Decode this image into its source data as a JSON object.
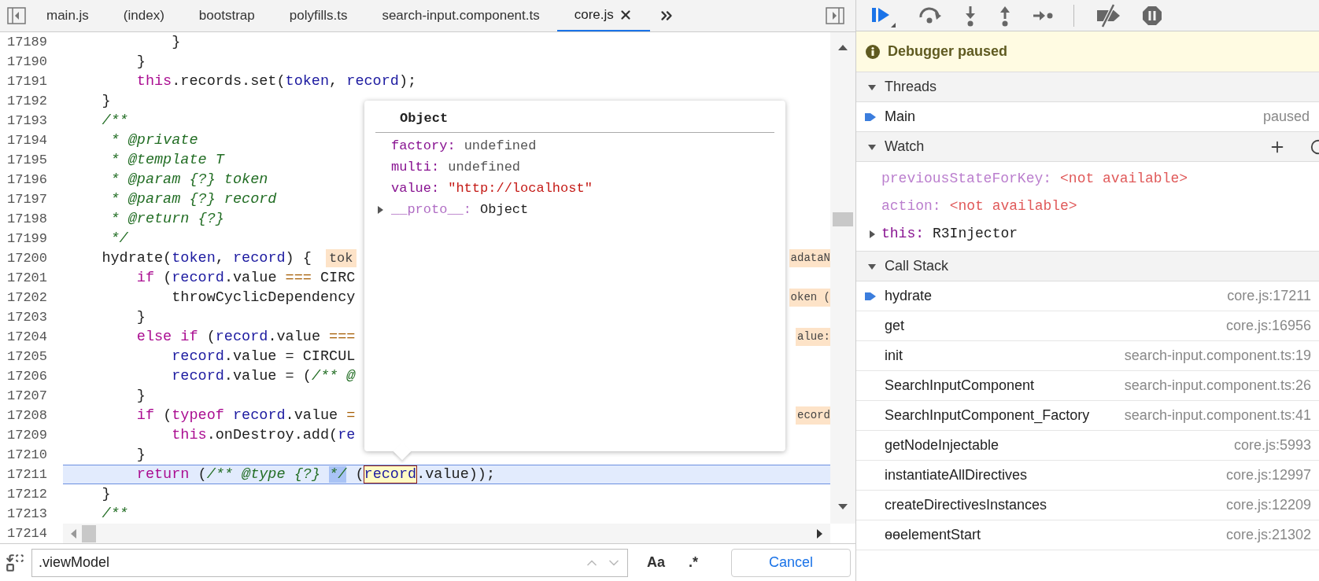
{
  "tabs": [
    {
      "label": "main.js",
      "selected": false,
      "closable": false
    },
    {
      "label": "(index)",
      "selected": false,
      "closable": false
    },
    {
      "label": "bootstrap",
      "selected": false,
      "closable": false
    },
    {
      "label": "polyfills.ts",
      "selected": false,
      "closable": false
    },
    {
      "label": "search-input.component.ts",
      "selected": false,
      "closable": false
    },
    {
      "label": "core.js",
      "selected": true,
      "closable": true
    }
  ],
  "editor": {
    "lines": [
      {
        "number": "17189",
        "current": false,
        "segments": [
          {
            "kind": "plain",
            "text": "            }"
          }
        ]
      },
      {
        "number": "17190",
        "current": false,
        "segments": [
          {
            "kind": "plain",
            "text": "        }"
          }
        ]
      },
      {
        "number": "17191",
        "current": false,
        "segments": [
          {
            "kind": "keyword",
            "text": "        this"
          },
          {
            "kind": "plain",
            "text": ".records.set("
          },
          {
            "kind": "variable",
            "text": "token"
          },
          {
            "kind": "plain",
            "text": ", "
          },
          {
            "kind": "variable",
            "text": "record"
          },
          {
            "kind": "plain",
            "text": ");"
          }
        ]
      },
      {
        "number": "17192",
        "current": false,
        "segments": [
          {
            "kind": "plain",
            "text": "    }"
          }
        ]
      },
      {
        "number": "17193",
        "current": false,
        "segments": [
          {
            "kind": "comment",
            "text": "    /**"
          }
        ]
      },
      {
        "number": "17194",
        "current": false,
        "segments": [
          {
            "kind": "comment",
            "text": "     * @private"
          }
        ]
      },
      {
        "number": "17195",
        "current": false,
        "segments": [
          {
            "kind": "comment",
            "text": "     * @template T"
          }
        ]
      },
      {
        "number": "17196",
        "current": false,
        "segments": [
          {
            "kind": "comment",
            "text": "     * @param {?} token"
          }
        ]
      },
      {
        "number": "17197",
        "current": false,
        "segments": [
          {
            "kind": "comment",
            "text": "     * @param {?} record"
          }
        ]
      },
      {
        "number": "17198",
        "current": false,
        "segments": [
          {
            "kind": "comment",
            "text": "     * @return {?}"
          }
        ]
      },
      {
        "number": "17199",
        "current": false,
        "segments": [
          {
            "kind": "comment",
            "text": "     */"
          }
        ]
      },
      {
        "number": "17200",
        "current": false,
        "segments": [
          {
            "kind": "plain",
            "text": "    hydrate("
          },
          {
            "kind": "variable",
            "text": "token"
          },
          {
            "kind": "plain",
            "text": ", "
          },
          {
            "kind": "variable",
            "text": "record"
          },
          {
            "kind": "plain",
            "text": ") {"
          }
        ],
        "inline_value": "tok",
        "right_value": "adataN"
      },
      {
        "number": "17201",
        "current": false,
        "segments": [
          {
            "kind": "keyword",
            "text": "        if"
          },
          {
            "kind": "plain",
            "text": " ("
          },
          {
            "kind": "variable",
            "text": "record"
          },
          {
            "kind": "plain",
            "text": ".value "
          },
          {
            "kind": "operator",
            "text": "==="
          },
          {
            "kind": "plain",
            "text": " CIRC"
          }
        ]
      },
      {
        "number": "17202",
        "current": false,
        "segments": [
          {
            "kind": "plain",
            "text": "            throwCyclicDependency"
          }
        ],
        "right_value": "oken ("
      },
      {
        "number": "17203",
        "current": false,
        "segments": [
          {
            "kind": "plain",
            "text": "        }"
          }
        ]
      },
      {
        "number": "17204",
        "current": false,
        "segments": [
          {
            "kind": "keyword",
            "text": "        else if"
          },
          {
            "kind": "plain",
            "text": " ("
          },
          {
            "kind": "variable",
            "text": "record"
          },
          {
            "kind": "plain",
            "text": ".value "
          },
          {
            "kind": "operator",
            "text": "==="
          }
        ],
        "right_value": "alue:"
      },
      {
        "number": "17205",
        "current": false,
        "segments": [
          {
            "kind": "variable",
            "text": "            record"
          },
          {
            "kind": "plain",
            "text": ".value = CIRCUL"
          }
        ]
      },
      {
        "number": "17206",
        "current": false,
        "segments": [
          {
            "kind": "variable",
            "text": "            record"
          },
          {
            "kind": "plain",
            "text": ".value = ("
          },
          {
            "kind": "comment",
            "text": "/** @"
          }
        ]
      },
      {
        "number": "17207",
        "current": false,
        "segments": [
          {
            "kind": "plain",
            "text": "        }"
          }
        ]
      },
      {
        "number": "17208",
        "current": false,
        "segments": [
          {
            "kind": "keyword",
            "text": "        if"
          },
          {
            "kind": "plain",
            "text": " ("
          },
          {
            "kind": "keyword",
            "text": "typeof"
          },
          {
            "kind": "variable",
            "text": " record"
          },
          {
            "kind": "plain",
            "text": ".value "
          },
          {
            "kind": "operator",
            "text": "="
          }
        ],
        "right_value": "ecord"
      },
      {
        "number": "17209",
        "current": false,
        "segments": [
          {
            "kind": "keyword",
            "text": "            this"
          },
          {
            "kind": "plain",
            "text": ".onDestroy.add("
          },
          {
            "kind": "variable",
            "text": "re"
          }
        ]
      },
      {
        "number": "17210",
        "current": false,
        "segments": [
          {
            "kind": "plain",
            "text": "        }"
          }
        ]
      },
      {
        "number": "17211",
        "current": true,
        "segments": [
          {
            "kind": "keyword",
            "text": "        return"
          },
          {
            "kind": "plain",
            "text": " ("
          },
          {
            "kind": "comment",
            "text": "/** @type {?} "
          },
          {
            "kind": "selected_comment",
            "text": "*/"
          },
          {
            "kind": "plain",
            "text": " ("
          },
          {
            "kind": "hovered",
            "text": "record"
          },
          {
            "kind": "plain",
            "text": ".value));"
          }
        ]
      },
      {
        "number": "17212",
        "current": false,
        "segments": [
          {
            "kind": "plain",
            "text": "    }"
          }
        ]
      },
      {
        "number": "17213",
        "current": false,
        "segments": [
          {
            "kind": "comment",
            "text": "    /**"
          }
        ]
      },
      {
        "number": "17214"
      }
    ]
  },
  "popover": {
    "title": "Object",
    "properties": [
      {
        "kind": "value",
        "key": "factory:",
        "value": "undefined"
      },
      {
        "kind": "value",
        "key": "multi:",
        "value": "undefined"
      },
      {
        "kind": "string",
        "key": "value:",
        "value": "\"http://localhost\""
      },
      {
        "kind": "object",
        "key": "__proto__:",
        "value": "Object"
      }
    ]
  },
  "search": {
    "value": ".viewModel",
    "match_case": "Aa",
    "regex": ".*",
    "cancel": "Cancel"
  },
  "debugger": {
    "banner": "Debugger paused",
    "threads": {
      "title": "Threads",
      "expanded": true,
      "items": [
        {
          "name": "Main",
          "status": "paused",
          "current": true
        }
      ]
    },
    "watch": {
      "title": "Watch",
      "expanded": true,
      "items": [
        {
          "kind": "unavailable",
          "name": "previousStateForKey:",
          "value": "<not available>"
        },
        {
          "kind": "unavailable",
          "name": "action:",
          "value": "<not available>"
        },
        {
          "kind": "object",
          "name": "this:",
          "value": "R3Injector",
          "expanded": false
        }
      ]
    },
    "call_stack": {
      "title": "Call Stack",
      "expanded": true,
      "frames": [
        {
          "name": "hydrate",
          "location": "core.js:17211",
          "current": true
        },
        {
          "name": "get",
          "location": "core.js:16956",
          "current": false
        },
        {
          "name": "init",
          "location": "search-input.component.ts:19",
          "current": false
        },
        {
          "name": "SearchInputComponent",
          "location": "search-input.component.ts:26",
          "current": false
        },
        {
          "name": "SearchInputComponent_Factory",
          "location": "search-input.component.ts:41",
          "current": false
        },
        {
          "name": "getNodeInjectable",
          "location": "core.js:5993",
          "current": false
        },
        {
          "name": "instantiateAllDirectives",
          "location": "core.js:12997",
          "current": false
        },
        {
          "name": "createDirectivesInstances",
          "location": "core.js:12209",
          "current": false
        },
        {
          "name": "ɵɵelementStart",
          "location": "core.js:21302",
          "current": false
        }
      ]
    }
  }
}
